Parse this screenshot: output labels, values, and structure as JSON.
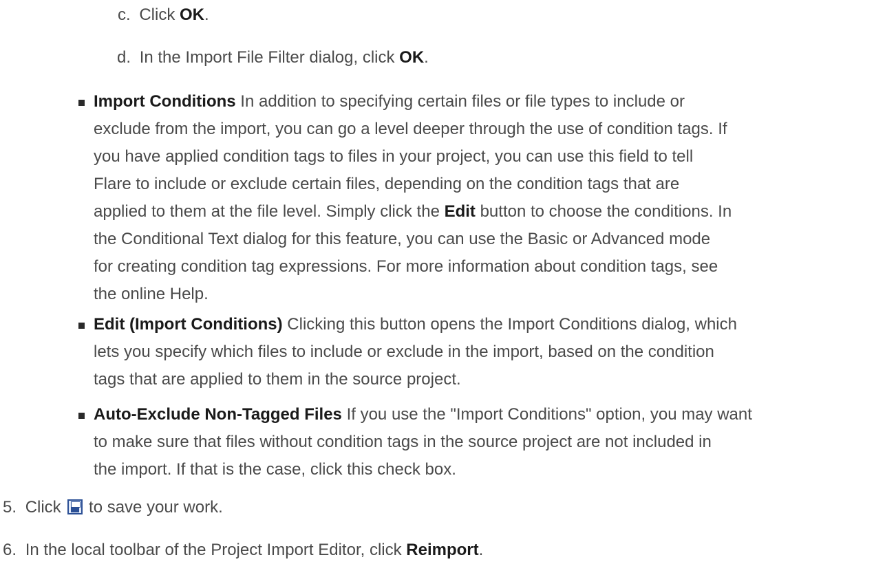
{
  "steps": [
    {
      "marker": "c.",
      "before": "Click ",
      "strong": "OK",
      "after": "."
    },
    {
      "marker": "d.",
      "before": "In the Import File Filter dialog, click ",
      "strong": "OK",
      "after": "."
    }
  ],
  "bullets": [
    {
      "term": "Import Conditions",
      "lines": [
        " In addition to specifying certain files or file types to include or",
        "exclude from the import, you can go a level deeper through the use of condition tags. If",
        "you have applied condition tags to files in your project, you can use this field to tell",
        "Flare to include or exclude certain files, depending on the condition tags that are"
      ],
      "line5_before": "applied to them at the file level. Simply click the ",
      "line5_strong": "Edit",
      "line5_after": " button to choose the conditions. In",
      "lines_tail": [
        "the Conditional Text dialog for this feature, you can use the Basic or Advanced mode",
        "for creating condition tag expressions. For more information about condition tags, see",
        "the online Help."
      ]
    },
    {
      "term": "Edit (Import Conditions)",
      "lines": [
        " Clicking this button opens the Import Conditions dialog, which",
        "lets you specify which files to include or exclude in the import, based on the condition",
        "tags that are applied to them in the source project."
      ]
    },
    {
      "term": "Auto-Exclude Non-Tagged Files",
      "lines": [
        " If you use the \"Import Conditions\" option, you may want",
        "to make sure that files without condition tags in the source project are not included in",
        "the import. If that is the case, click this check box."
      ]
    }
  ],
  "step5": {
    "marker": "5.",
    "before": "Click ",
    "icon": "save-icon",
    "after": " to save your work."
  },
  "step6": {
    "marker": "6.",
    "before": "In the local toolbar of the Project Import Editor, click ",
    "strong": "Reimport",
    "after": "."
  }
}
